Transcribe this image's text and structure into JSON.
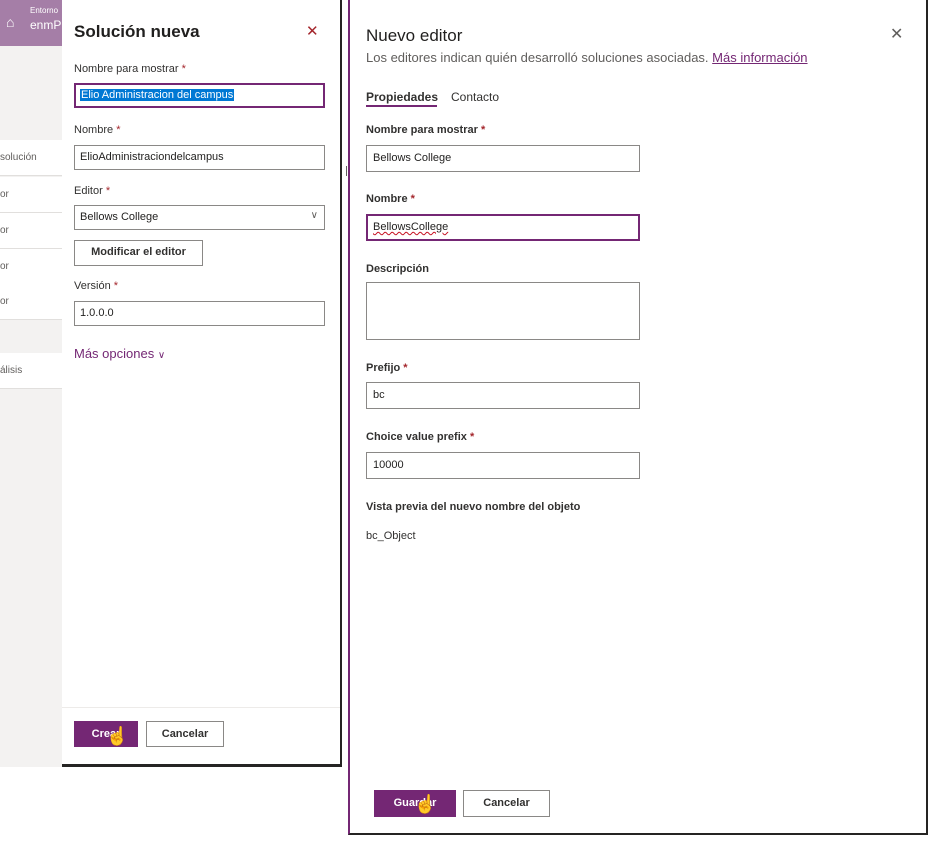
{
  "background_app": {
    "env_label": "Entorno",
    "env_name": "enmP",
    "rows": [
      "solución",
      "or",
      "or",
      "or",
      "or",
      "álisis"
    ]
  },
  "solution_panel": {
    "title": "Solución nueva",
    "close_icon": "close-icon",
    "display_name_label": "Nombre para mostrar",
    "display_name_value": "Elio Administracion del campus",
    "name_label": "Nombre",
    "name_value": "ElioAdministraciondelcampus",
    "publisher_label": "Editor",
    "publisher_value": "Bellows College",
    "edit_publisher_button": "Modificar el editor",
    "version_label": "Versión",
    "version_value": "1.0.0.0",
    "more_options": "Más opciones",
    "create_button": "Crear",
    "cancel_button": "Cancelar",
    "required_mark": "*"
  },
  "publisher_panel": {
    "title": "Nuevo editor",
    "close_icon": "close-icon",
    "description": "Los editores indican quién desarrolló soluciones asociadas.",
    "learn_more": "Más información",
    "tabs": [
      {
        "label": "Propiedades",
        "active": true
      },
      {
        "label": "Contacto",
        "active": false
      }
    ],
    "display_name_label": "Nombre para mostrar",
    "display_name_value": "Bellows College",
    "name_label": "Nombre",
    "name_value": "BellowsCollege",
    "description_label": "Descripción",
    "description_value": "",
    "prefix_label": "Prefijo",
    "prefix_value": "bc",
    "choice_prefix_label": "Choice value prefix",
    "choice_prefix_value": "10000",
    "preview_label": "Vista previa del nuevo nombre del objeto",
    "preview_value": "bc_Object",
    "save_button": "Guardar",
    "cancel_button": "Cancelar",
    "required_mark": "*"
  },
  "colors": {
    "accent": "#742774",
    "required": "#a4262c",
    "selection": "#0078d4",
    "env_bar": "#a57ea7"
  }
}
